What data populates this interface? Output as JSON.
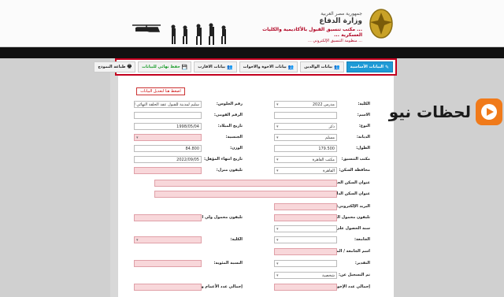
{
  "header": {
    "republic": "جمهورية مصر العربية",
    "ministry": "وزارة الدفاع",
    "office": "... مكتب تنسيق القبول بالأكاديمية والكليات العسكرية ...",
    "system": "... منظومة التنسيق الإلكتروني ..."
  },
  "tabs": [
    {
      "icon": "✎",
      "label": "البيانات الأساسية",
      "active": true
    },
    {
      "icon": "👥",
      "label": "بيانات الوالدين",
      "active": false
    },
    {
      "icon": "👥",
      "label": "بيانات الاخوة والاخوات",
      "active": false
    },
    {
      "icon": "👥",
      "label": "بيانات الاقارب",
      "active": false
    },
    {
      "icon": "💾",
      "label": "حفظ نهائي للبيانات",
      "active": false
    },
    {
      "icon": "🖶",
      "label": "طباعة النموذج",
      "active": false
    }
  ],
  "unlock_button": "اضغط هنا لتعديل البيانات",
  "form": {
    "college_label": "الكلية:",
    "college_value": "مدرس 2022",
    "name_label": "الاسم:",
    "seat_label": "رقم الجلوس:",
    "seat_value": "سليم لمدينة للقبول عقد الحلقة النهائي للبيانات",
    "national_id_label": "الرقم القومي:",
    "gender_label": "النوع:",
    "gender_value": "ذكر",
    "birth_label": "تاريخ الميلاد:",
    "birth_value": "1998/05/04",
    "religion_label": "الديانة:",
    "religion_value": "مسلم",
    "nationality_label": "الجنسية:",
    "height_label": "الطول:",
    "height_value": "179.500",
    "weight_label": "الوزن:",
    "weight_value": "84.800",
    "coord_office_label": "مكتب التنسيق:",
    "coord_office_value": "مكتب القاهرة",
    "exam_date_label": "تاريخ انتهاء المؤهل:",
    "exam_date_value": "2022/09/05",
    "governorate_label": "محافظة السكن:",
    "governorate_value": "القاهرة",
    "home_phone_label": "تليفون منزل:",
    "address_label": "عنوان السكن الحالي:",
    "perm_address_label": "عنوان السكن الدائم بالبطاقة:",
    "email_label": "البريد الإلكتروني:",
    "mobile_label": "تليفون محمول الطالب:",
    "guardian_mobile_label": "تليفون محمول ولي الأمر:",
    "grad_year_label": "سنة الحصول على المؤهل:",
    "university_label": "الجامعة:",
    "faculty_label": "الكلية:",
    "institute_label": "اسم الجامعة / المعهد:",
    "grade_label": "التقدير:",
    "percent_label": "النسبة المئوية:",
    "reg_label": "تم التسجيل عن:",
    "reg_value": "شخصية",
    "siblings_label": "إجمالي عدد الإخوة والأخوات:",
    "aunts_label": "إجمالي عدد الأعمام والعمات والأخوال والخالات:"
  },
  "watermark": {
    "text": "لحظات نيو",
    "logo": "play-logo-icon"
  }
}
